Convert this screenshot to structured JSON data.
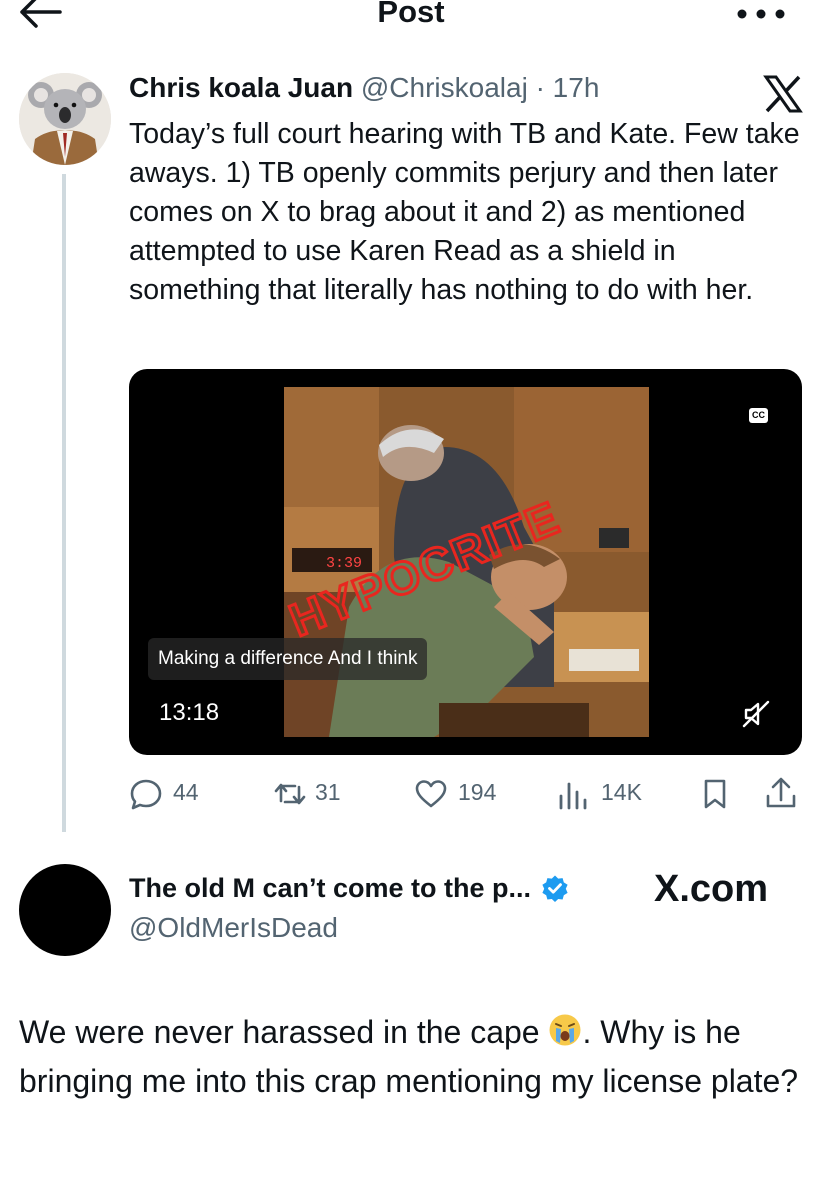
{
  "topbar": {
    "title": "Post"
  },
  "tweet": {
    "author_name": "Chris koala Juan",
    "handle_time": "@Chriskoalaj · 17h",
    "text": "Today’s full court hearing with TB and Kate. Few take aways. 1) TB openly commits perjury and then later comes on X to brag about it and 2) as mentioned attempted to use Karen Read as a shield in something that literally has nothing to do with her.",
    "media": {
      "cc_label": "CC",
      "overlay_text": "HYPOCRITE",
      "clock_digits": "3:39",
      "subtitle": "Making a difference And I think",
      "duration": "13:18"
    },
    "actions": {
      "replies": "44",
      "reposts": "31",
      "likes": "194",
      "views": "14K"
    }
  },
  "reply": {
    "author_name": "The old M can’t come to the p...",
    "handle": "@OldMerIsDead",
    "brand": "X.com",
    "text_part1": "We were never harassed in the cape ",
    "text_part2": ". Why is he bringing me into this crap mentioning my license plate?"
  },
  "colors": {
    "text": "#0f1419",
    "secondary": "#536471",
    "verified": "#1d9bf0",
    "overlay_red": "#e8261f"
  }
}
